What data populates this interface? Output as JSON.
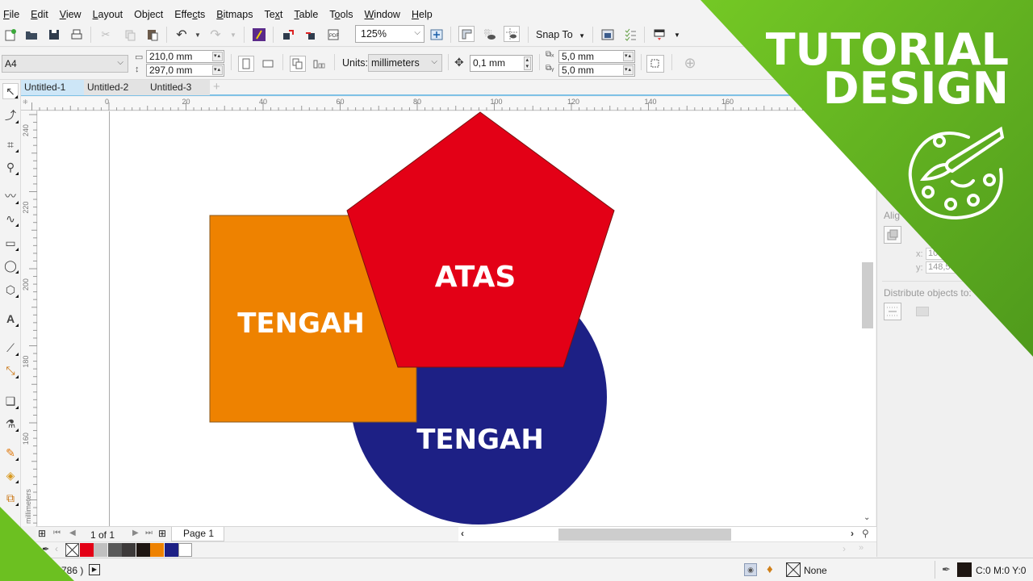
{
  "menu": [
    "File",
    "Edit",
    "View",
    "Layout",
    "Object",
    "Effects",
    "Bitmaps",
    "Text",
    "Table",
    "Tools",
    "Window",
    "Help"
  ],
  "menu_mnemonics": [
    "F",
    "E",
    "V",
    "L",
    "j",
    "c",
    "B",
    "x",
    "T",
    "o",
    "W",
    "H"
  ],
  "toolbar": {
    "zoom_level": "125%",
    "snap_to": "Snap To",
    "icons": [
      "new-document-icon",
      "open-icon",
      "save-icon",
      "print-icon",
      "cut-icon",
      "copy-icon",
      "paste-icon",
      "undo-icon",
      "redo-icon",
      "corel-connect-icon",
      "import-icon",
      "export-icon",
      "publish-pdf-icon",
      "zoom-level",
      "full-screen-preview-icon",
      "show-rulers-icon",
      "show-grid-icon",
      "show-guidelines-icon",
      "snap-to",
      "welcome-screen-icon",
      "options-icon",
      "application-launcher-icon"
    ]
  },
  "property_bar": {
    "paper_size": "A4",
    "width": "210,0 mm",
    "height": "297,0 mm",
    "units_label": "Units:",
    "units": "millimeters",
    "nudge": "0,1 mm",
    "dup_x": "5,0 mm",
    "dup_y": "5,0 mm"
  },
  "tabs": [
    {
      "label": "Untitled-1",
      "active": true
    },
    {
      "label": "Untitled-2",
      "active": false
    },
    {
      "label": "Untitled-3",
      "active": false
    }
  ],
  "rulers": {
    "horizontal": [
      "0",
      "20",
      "40",
      "60",
      "80",
      "100",
      "120",
      "140",
      "160"
    ],
    "vertical": [
      "240",
      "220",
      "200",
      "180",
      "160"
    ],
    "unit_label": "millimeters"
  },
  "canvas": {
    "shapes": [
      {
        "type": "rectangle",
        "label": "TENGAH",
        "fill": "#ee8200"
      },
      {
        "type": "pentagon",
        "label": "ATAS",
        "fill": "#e30016"
      },
      {
        "type": "ellipse",
        "label": "TENGAH",
        "fill": "#1d2085"
      }
    ]
  },
  "docker": {
    "align_label": "Alig",
    "x_label": "x:",
    "x_value": "10",
    "y_label": "y:",
    "y_value": "148,5",
    "distribute_label": "Distribute objects to:"
  },
  "page_nav": {
    "page_count": "1 of 1",
    "page_tab": "Page 1"
  },
  "palette": [
    "none",
    "#e30016",
    "#c0c0c0",
    "#595959",
    "#3d3a3a",
    "#1e1612",
    "#ee8200",
    "#1d2085",
    "#ffffff"
  ],
  "status": {
    "coords_fragment": "786 )",
    "fill_label": "None",
    "outline_color": "#1e1612",
    "outline_value": "C:0 M:0 Y:0"
  },
  "banner": {
    "line1": "TUTORIAL",
    "line2": "DESIGN",
    "color": "#6cc021"
  }
}
